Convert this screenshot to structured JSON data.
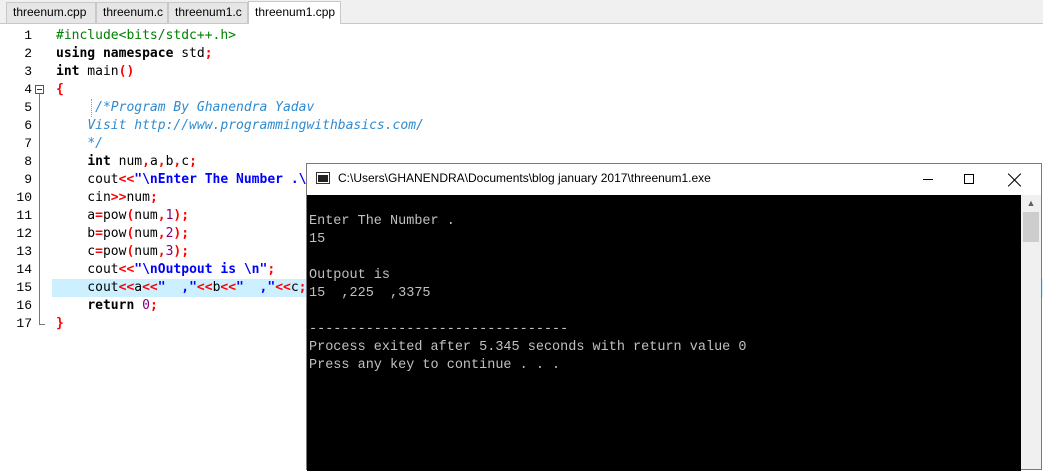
{
  "tabs": [
    {
      "label": "threenum.cpp"
    },
    {
      "label": "threenum.c"
    },
    {
      "label": "threenum1.c"
    },
    {
      "label": "threenum1.cpp"
    }
  ],
  "editor": {
    "line_numbers": [
      "1",
      "2",
      "3",
      "4",
      "5",
      "6",
      "7",
      "8",
      "9",
      "10",
      "11",
      "12",
      "13",
      "14",
      "15",
      "16",
      "17"
    ],
    "active_line": 15
  },
  "console": {
    "title": "C:\\Users\\GHANENDRA\\Documents\\blog january 2017\\threenum1.exe",
    "minimize_icon": "minimize-icon",
    "maximize_icon": "maximize-icon",
    "close_icon": "close-icon",
    "output_lines": [
      "",
      "Enter The Number .",
      "15",
      "",
      "Outpout is",
      "15  ,225  ,3375",
      "",
      "--------------------------------",
      "Process exited after 5.345 seconds with return value 0",
      "Press any key to continue . . ."
    ]
  },
  "colors": {
    "keyword": "#000000",
    "preprocessor": "#008000",
    "comment": "#2e8bd0",
    "string": "#0000ff",
    "symbol": "#ff0000",
    "number": "#800080",
    "active_line_bg": "#ccf0ff",
    "console_bg": "#000000",
    "console_text": "#c0c0c0"
  }
}
